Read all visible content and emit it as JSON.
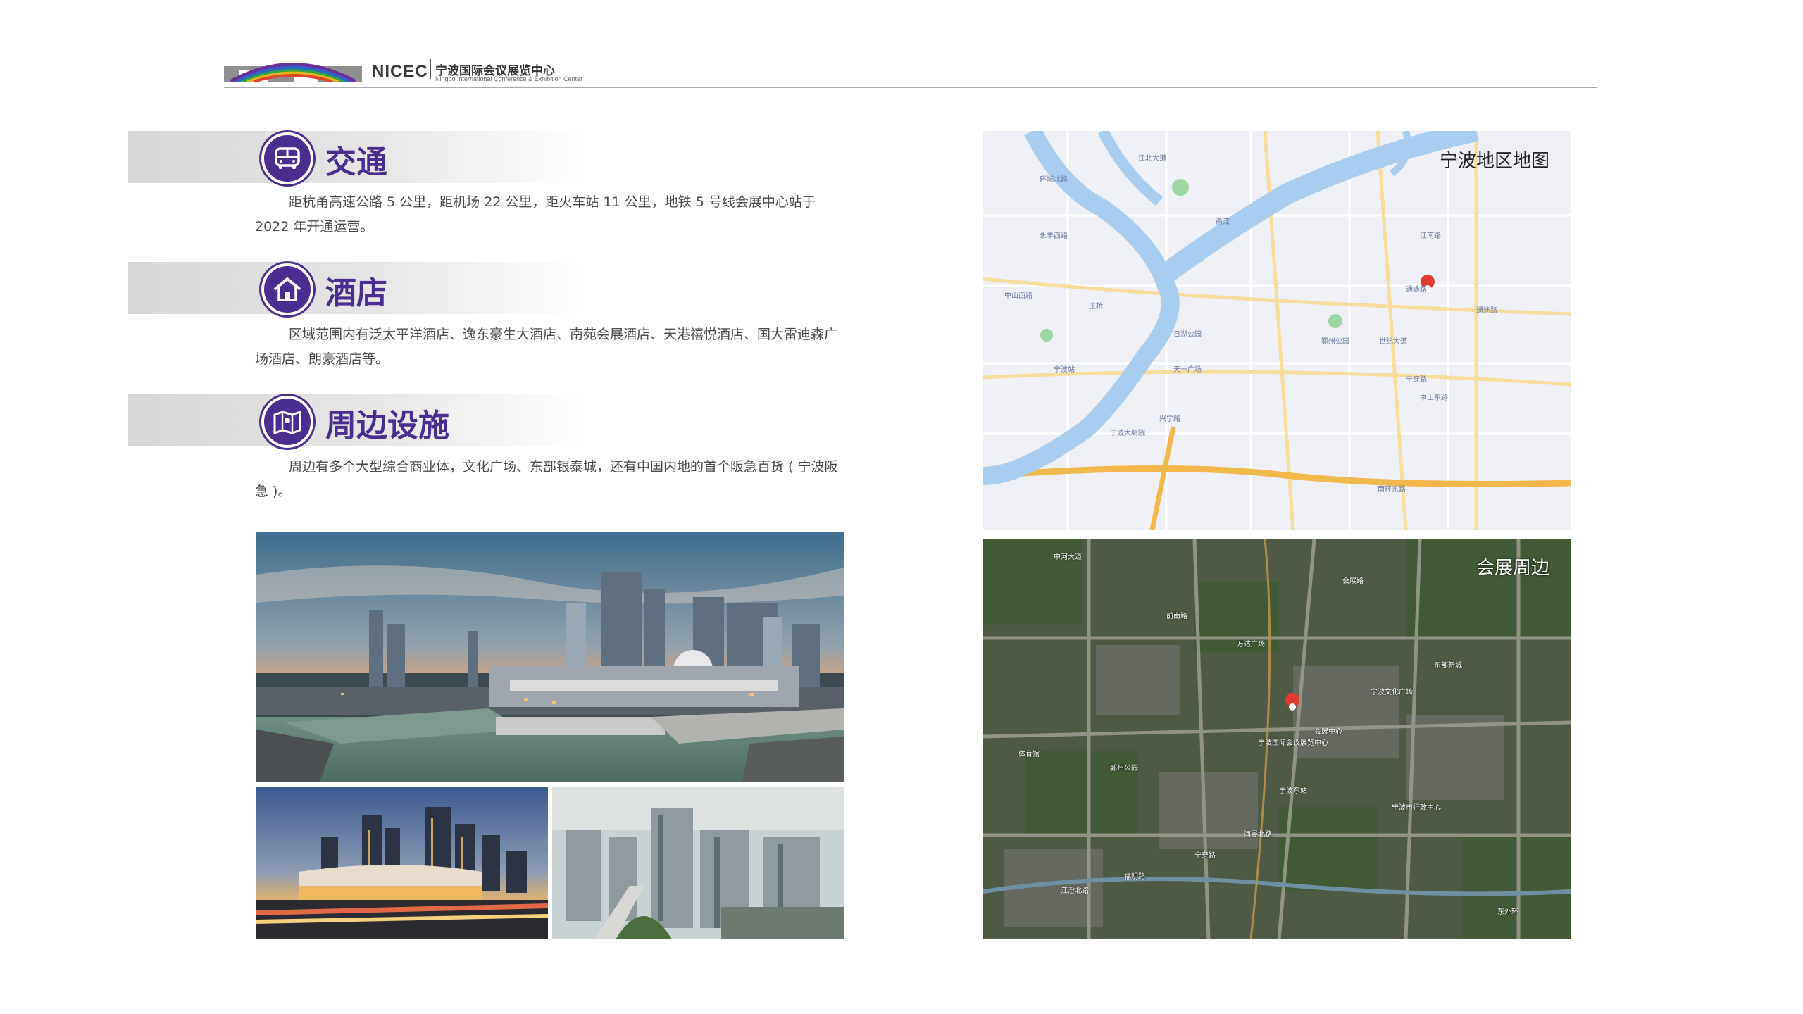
{
  "header": {
    "logo_text": "NICEC",
    "logo_cn": "宁波国际会议展览中心",
    "logo_en": "Ningbo International Conference & Exhibition Center"
  },
  "sections": [
    {
      "title": "交通",
      "icon": "bus-icon",
      "text": "距杭甬高速公路 5 公里，距机场 22 公里，距火车站 11 公里，地铁 5 号线会展中心站于 2022 年开通运营。"
    },
    {
      "title": "酒店",
      "icon": "house-icon",
      "text": "区域范围内有泛太平洋酒店、逸东豪生大酒店、南苑会展酒店、天港禧悦酒店、国大雷迪森广场酒店、朗豪酒店等。"
    },
    {
      "title": "周边设施",
      "icon": "map-icon",
      "text": "周边有多个大型综合商业体，文化广场、东部银泰城，还有中国内地的首个阪急百货 ( 宁波阪急 )。"
    }
  ],
  "maps": {
    "region_label": "宁波地区地图",
    "nearby_label": "会展周边",
    "region_pois": [
      "环城北路",
      "江北大道",
      "甬江",
      "庄桥",
      "永丰西路",
      "中山西路",
      "中山东路",
      "宁穿路",
      "兴宁路",
      "南环东路",
      "通途路",
      "通途路",
      "世纪大道",
      "江南路",
      "日湖公园",
      "宁波站",
      "鄞州公园",
      "宁波大剧院",
      "天一广场"
    ],
    "nearby_pois": [
      "中河大道",
      "前南路",
      "宁波国际会议展览中心",
      "会展中心",
      "鄞州公园",
      "宁波东站",
      "体育馆",
      "东部新城",
      "万达广场",
      "海晏北路",
      "会展路",
      "宁波文化广场",
      "福明路",
      "宁穿路",
      "江澄北路",
      "宁波市行政中心",
      "东外环"
    ]
  },
  "colors": {
    "accent": "#4b2d8f",
    "rule": "#a9a9a9"
  }
}
